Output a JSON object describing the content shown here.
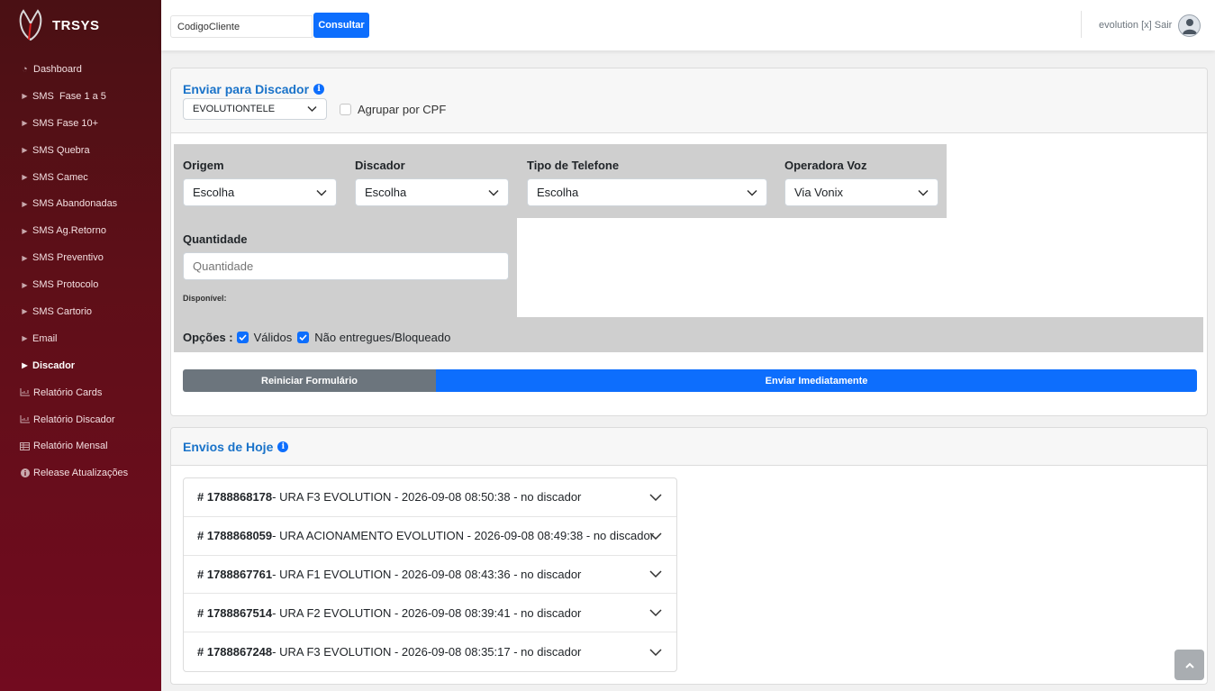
{
  "brand": {
    "name": "TRSYS"
  },
  "sidebar": {
    "items": [
      {
        "label": "Dashboard",
        "icon": "dashboard-icon"
      },
      {
        "label": "SMS  Fase 1 a 5",
        "icon": "caret-right-icon"
      },
      {
        "label": "SMS Fase 10+",
        "icon": "caret-right-icon"
      },
      {
        "label": "SMS Quebra",
        "icon": "caret-right-icon"
      },
      {
        "label": "SMS Camec",
        "icon": "caret-right-icon"
      },
      {
        "label": "SMS Abandonadas",
        "icon": "caret-right-icon"
      },
      {
        "label": "SMS Ag.Retorno",
        "icon": "caret-right-icon"
      },
      {
        "label": "SMS Preventivo",
        "icon": "caret-right-icon"
      },
      {
        "label": "SMS Protocolo",
        "icon": "caret-right-icon"
      },
      {
        "label": "SMS Cartorio",
        "icon": "caret-right-icon"
      },
      {
        "label": "Email",
        "icon": "caret-right-icon"
      },
      {
        "label": "Discador",
        "icon": "caret-right-icon",
        "active": true
      },
      {
        "label": "Relatório Cards",
        "icon": "chart-icon"
      },
      {
        "label": "Relatório Discador",
        "icon": "chart-icon"
      },
      {
        "label": "Relatório Mensal",
        "icon": "table-icon"
      },
      {
        "label": "Release Atualizações",
        "icon": "info-icon"
      }
    ]
  },
  "topbar": {
    "search_value": "CodigoCliente",
    "consultar_label": "Consultar",
    "user_text": "evolution [x] Sair"
  },
  "send_card": {
    "title": "Enviar para Discador",
    "discador_select": "EVOLUTIONTELE",
    "group_cpf_label": "Agrupar por CPF",
    "origem_label": "Origem",
    "origem_value": "Escolha",
    "discador_label": "Discador",
    "discador_value": "Escolha",
    "tipo_label": "Tipo de Telefone",
    "tipo_value": "Escolha",
    "operadora_label": "Operadora Voz",
    "operadora_value": "Via Vonix",
    "quantidade_label": "Quantidade",
    "quantidade_placeholder": "Quantidade",
    "disponivel_label": "Disponível:",
    "opcoes_label": "Opções :",
    "validos_label": "Válidos",
    "nao_entregues_label": "Não entregues/Bloqueado",
    "reset_label": "Reiniciar Formulário",
    "send_label": "Enviar Imediatamente"
  },
  "today_card": {
    "title": "Envios de Hoje",
    "items": [
      {
        "id": "# 1788868178",
        "text": "- URA F3 EVOLUTION - 2026-09-08 08:50:38 - no discador"
      },
      {
        "id": "# 1788868059",
        "text": "- URA ACIONAMENTO EVOLUTION - 2026-09-08 08:49:38 - no discador"
      },
      {
        "id": "# 1788867761",
        "text": "- URA F1 EVOLUTION - 2026-09-08 08:43:36 - no discador"
      },
      {
        "id": "# 1788867514",
        "text": "- URA F2 EVOLUTION - 2026-09-08 08:39:41 - no discador"
      },
      {
        "id": "# 1788867248",
        "text": "- URA F3 EVOLUTION - 2026-09-08 08:35:17 - no discador"
      }
    ]
  },
  "colors": {
    "primary": "#0d6efd",
    "secondary": "#6c757d",
    "sidebar": "#6a0d1c",
    "title": "#1a73c9"
  }
}
